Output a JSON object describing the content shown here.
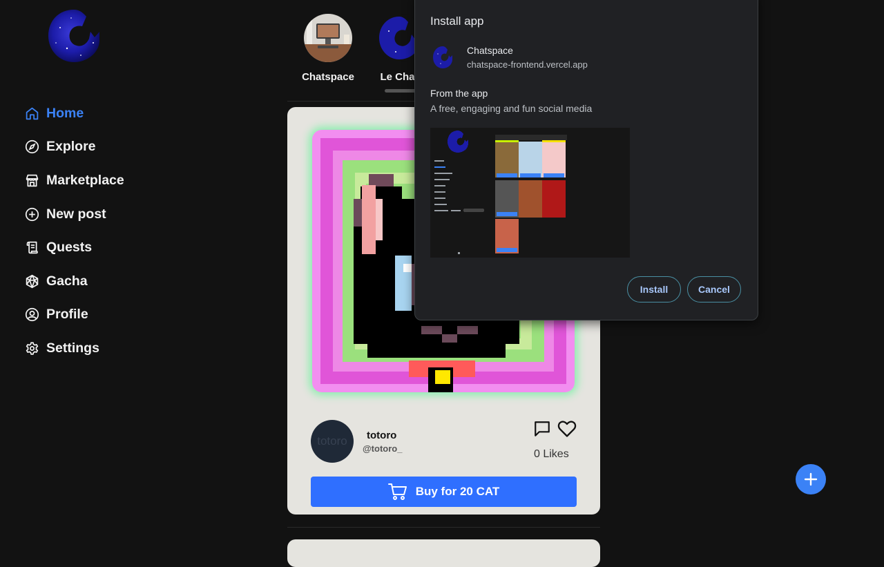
{
  "sidebar": {
    "items": [
      {
        "label": "Home",
        "icon": "home-icon",
        "active": true
      },
      {
        "label": "Explore",
        "icon": "compass-icon",
        "active": false
      },
      {
        "label": "Marketplace",
        "icon": "store-icon",
        "active": false
      },
      {
        "label": "New post",
        "icon": "plus-circle-icon",
        "active": false
      },
      {
        "label": "Quests",
        "icon": "scroll-icon",
        "active": false
      },
      {
        "label": "Gacha",
        "icon": "gem-icon",
        "active": false
      },
      {
        "label": "Profile",
        "icon": "user-circle-icon",
        "active": false
      },
      {
        "label": "Settings",
        "icon": "gear-icon",
        "active": false
      }
    ]
  },
  "stories": [
    {
      "name": "Chatspace"
    },
    {
      "name": "Le Chat"
    }
  ],
  "post": {
    "author_name": "totoro",
    "author_handle": "@totoro_",
    "avatar_fallback": "totoro",
    "likes": "0 Likes",
    "buy_label": "Buy for 20 CAT"
  },
  "install_dialog": {
    "title": "Install app",
    "app_name": "Chatspace",
    "app_url": "chatspace-frontend.vercel.app",
    "from_label": "From the app",
    "description": "A free, engaging and fun social media",
    "install_label": "Install",
    "cancel_label": "Cancel"
  },
  "colors": {
    "accent": "#3b82f6",
    "background": "#121212",
    "card": "#e5e4df",
    "buy_button": "#2f6fff",
    "nft_glow": "#86efac"
  }
}
